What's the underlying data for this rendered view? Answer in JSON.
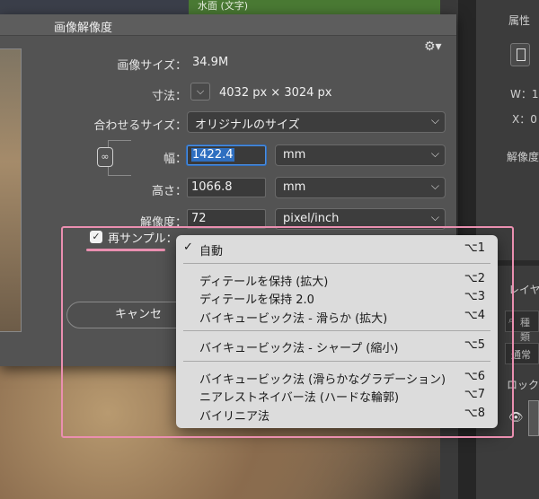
{
  "background": {
    "layer_name": "水面 (文字)",
    "properties_title": "属性",
    "w_label": "W：1",
    "x_label": "X：0",
    "resolution_short": "解像度",
    "layers_title": "レイヤ",
    "search_placeholder": "種類",
    "blend_mode": "通常",
    "lock_label": "ロック"
  },
  "dialog": {
    "title": "画像解像度",
    "image_size_label": "画像サイズ：",
    "image_size_value": "34.9M",
    "dimensions_label": "寸法：",
    "dimensions_value": "4032 px × 3024 px",
    "fit_to_label": "合わせるサイズ：",
    "fit_to_value": "オリジナルのサイズ",
    "width_label": "幅：",
    "width_value": "1422.4",
    "width_unit": "mm",
    "height_label": "高さ：",
    "height_value": "1066.8",
    "height_unit": "mm",
    "resolution_label": "解像度：",
    "resolution_value": "72",
    "resolution_unit": "pixel/inch",
    "resample_label": "再サンプル：",
    "resample_checked": true,
    "cancel_label": "キャンセ"
  },
  "resample_menu": {
    "items": [
      {
        "label": "自動",
        "shortcut": "⌥1",
        "checked": true
      },
      {
        "label": "ディテールを保持 (拡大)",
        "shortcut": "⌥2"
      },
      {
        "label": "ディテールを保持 2.0",
        "shortcut": "⌥3"
      },
      {
        "label": "バイキュービック法 - 滑らか (拡大)",
        "shortcut": "⌥4"
      },
      {
        "label": "バイキュービック法 - シャープ (縮小)",
        "shortcut": "⌥5"
      },
      {
        "label": "バイキュービック法 (滑らかなグラデーション)",
        "shortcut": "⌥6"
      },
      {
        "label": "ニアレストネイバー法 (ハードな輪郭)",
        "shortcut": "⌥7"
      },
      {
        "label": "バイリニア法",
        "shortcut": "⌥8"
      }
    ]
  },
  "colors": {
    "highlight": "#ea8fb0",
    "selection": "#2f6fc0",
    "layer_green": "#4a7a34"
  }
}
